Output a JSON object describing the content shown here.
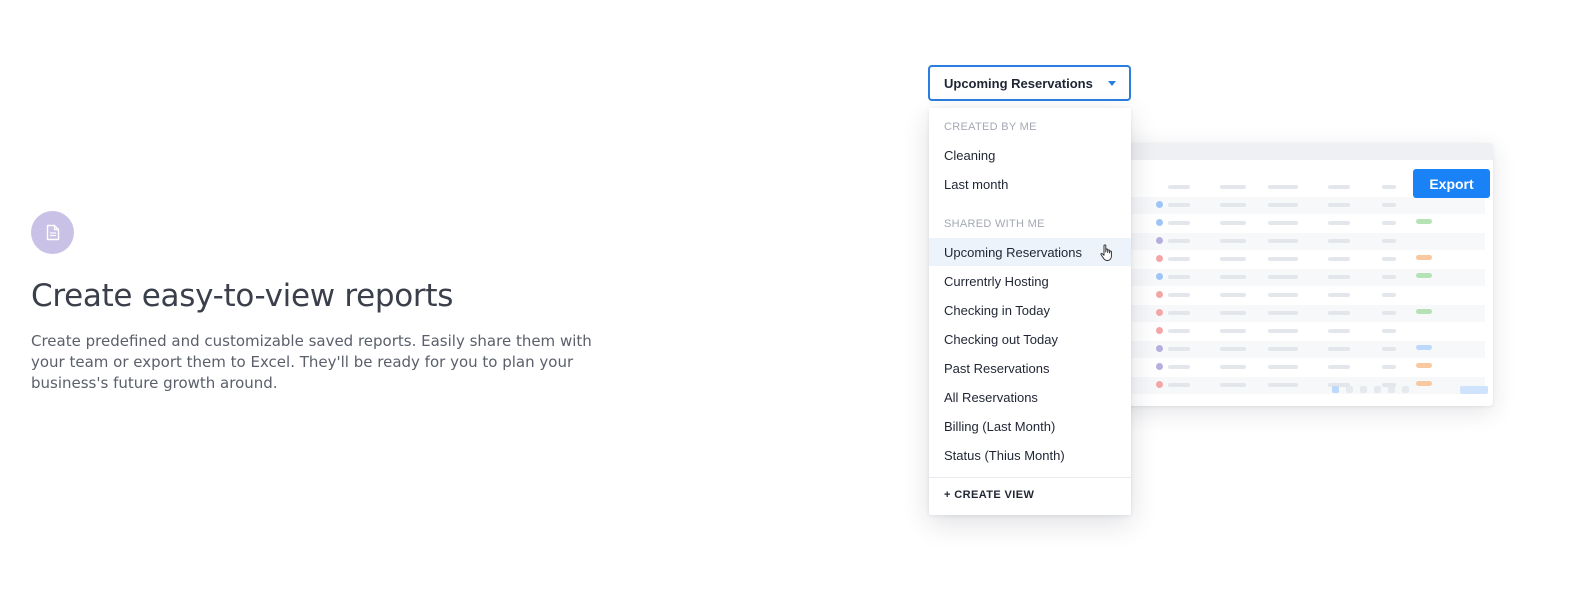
{
  "feature": {
    "icon": "document-icon",
    "icon_color": "#c9c1e6",
    "title": "Create easy-to-view reports",
    "description": "Create predefined and customizable saved reports. Easily share them with your team or export them to Excel. They'll be ready for you to plan your business's future growth around."
  },
  "report_preview": {
    "export_label": "Export",
    "export_color": "#1a82f7"
  },
  "view_select": {
    "selected": "Upcoming Reservations",
    "accent_color": "#2a7de1",
    "groups": [
      {
        "heading": "CREATED BY ME",
        "items": [
          "Cleaning",
          "Last month"
        ]
      },
      {
        "heading": "SHARED WITH ME",
        "items": [
          "Upcoming Reservations",
          "Currentrly Hosting",
          "Checking in Today",
          "Checking out Today",
          "Past Reservations",
          "All Reservations",
          "Billing (Last Month)",
          "Status (Thius Month)"
        ]
      }
    ],
    "active_item": "Upcoming Reservations",
    "create_label": "+ CREATE VIEW"
  }
}
